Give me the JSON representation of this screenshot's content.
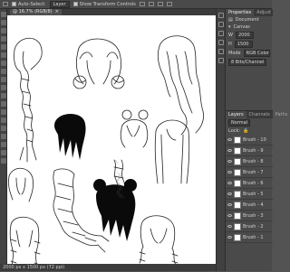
{
  "options_bar": {
    "auto_select_label": "Auto-Select:",
    "auto_select_value": "Layer",
    "show_transform_label": "Show Transform Controls"
  },
  "document": {
    "tab_title": "@ 16.7% (RGB/8)"
  },
  "status_bar": {
    "text": "2000 px x 1500 px (72 ppi)"
  },
  "properties_panel": {
    "tabs": [
      "Properties",
      "Adjust"
    ],
    "section": "Document",
    "canvas_label": "Canvas",
    "width_label": "W",
    "height_label": "H",
    "width_value": "2000",
    "height_value": "1500",
    "mode_label": "Mode",
    "mode_value": "RGB Color",
    "depth_value": "8 Bits/Channel"
  },
  "layers_panel": {
    "tabs": [
      "Layers",
      "Channels",
      "Paths"
    ],
    "blend_mode": "Normal",
    "lock_label": "Lock:",
    "items": [
      {
        "name": "Brush - 10"
      },
      {
        "name": "Brush - 9"
      },
      {
        "name": "Brush - 8"
      },
      {
        "name": "Brush - 7"
      },
      {
        "name": "Brush - 6"
      },
      {
        "name": "Brush - 5"
      },
      {
        "name": "Brush - 4"
      },
      {
        "name": "Brush - 3"
      },
      {
        "name": "Brush - 2"
      },
      {
        "name": "Brush - 1"
      }
    ]
  },
  "tool_icons": [
    "move-tool",
    "marquee-tool",
    "lasso-tool",
    "crop-tool",
    "eyedropper-tool",
    "heal-tool",
    "brush-tool",
    "stamp-tool",
    "history-brush-tool",
    "eraser-tool",
    "gradient-tool",
    "blur-tool",
    "dodge-tool",
    "pen-tool",
    "type-tool",
    "path-select-tool",
    "shape-tool",
    "hand-tool",
    "zoom-tool"
  ]
}
